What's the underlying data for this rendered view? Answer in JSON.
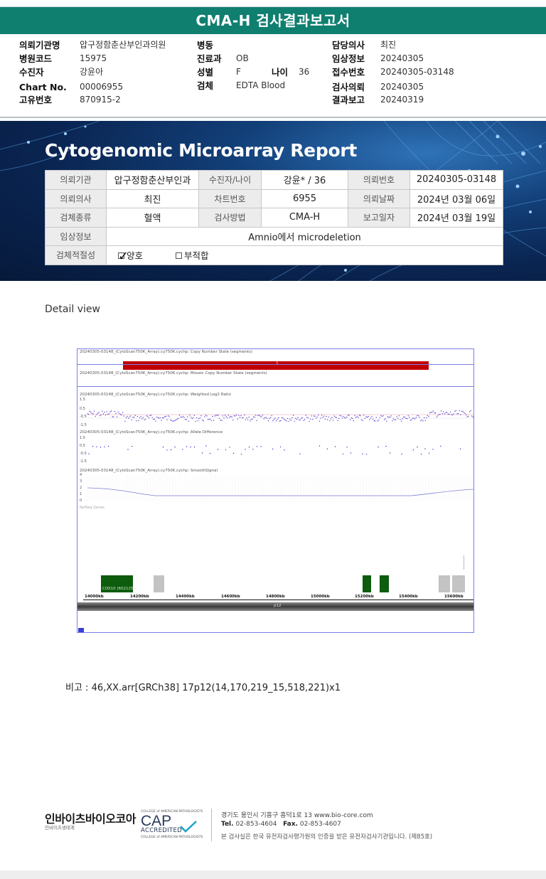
{
  "document_title": "CMA-H 검사결과보고서",
  "header": {
    "col1": [
      {
        "label": "의뢰기관명",
        "value": "압구정함춘산부인과의원"
      },
      {
        "label": "병원코드",
        "value": "15975"
      },
      {
        "label": "수진자",
        "value": "강윤아"
      },
      {
        "label": "Chart No.",
        "value": "00006955"
      },
      {
        "label": "고유번호",
        "value": "870915-2"
      }
    ],
    "col2": [
      {
        "label": "병동",
        "value": ""
      },
      {
        "label": "진료과",
        "value": "OB"
      },
      {
        "label": "성별",
        "value": "F"
      },
      {
        "label": "검체",
        "value": "EDTA Blood"
      }
    ],
    "age": {
      "label": "나이",
      "value": "36"
    },
    "col3": [
      {
        "label": "담당의사",
        "value": "최진"
      },
      {
        "label": "임상정보",
        "value": "20240305"
      },
      {
        "label": "접수번호",
        "value": "20240305-03148"
      },
      {
        "label": "검사의뢰",
        "value": "20240305"
      },
      {
        "label": "결과보고",
        "value": "20240319"
      }
    ]
  },
  "report": {
    "title": "Cytogenomic Microarray Report",
    "table": {
      "r1": {
        "h1": "의뢰기관",
        "v1": "압구정함춘산부인과",
        "h2": "수진자/나이",
        "v2": "강윤* / 36",
        "h3": "의뢰번호",
        "v3": "20240305-03148"
      },
      "r2": {
        "h1": "의뢰의사",
        "v1": "최진",
        "h2": "차트번호",
        "v2": "6955",
        "h3": "의뢰날짜",
        "v3": "2024년 03월 06일"
      },
      "r3": {
        "h1": "검체종류",
        "v1": "혈액",
        "h2": "검사방법",
        "v2": "CMA-H",
        "h3": "보고일자",
        "v3": "2024년 03월 19일"
      },
      "r4": {
        "h1": "임상정보",
        "v1": "Amnio에서 microdeletion"
      },
      "r5": {
        "h1": "검체적절성",
        "opt1": "양호",
        "opt2": "부적합",
        "selected": "양호"
      }
    }
  },
  "detail": {
    "label": "Detail view",
    "tracks": {
      "t1": "20240305-03148_(CytoScan750K_Array).cy750K.cychp: Copy Number State (segments)",
      "t2": "20240305-03148_(CytoScan750K_Array).cy750K.cychp: Mosaic Copy Number State (segments)",
      "t3": "20240305-03148_(CytoScan750K_Array).cy750K.cychp: Weighted Log2 Ratio",
      "t4": "20240305-03148_(CytoScan750K_Array).cy750K.cychp: Allele Difference",
      "t5": "20240305-03148_(CytoScan750K_Array).cy750K.cychp: SmoothSignal"
    },
    "cnv_marker": "1",
    "log2_ticks": [
      "1.5",
      "0.5",
      "-0.5",
      "-1.5"
    ],
    "allele_ticks": [
      "1.5",
      "0.5",
      "-0.5",
      "-1.5"
    ],
    "smooth_ticks": [
      "4",
      "3",
      "2",
      "1",
      "0"
    ],
    "refseq_label": "RefSeq Genes",
    "gene_label": "COX10 (602125)",
    "x_ticks": [
      "14000kb",
      "14200kb",
      "14400kb",
      "14600kb",
      "14800kb",
      "15000kb",
      "15200kb",
      "15400kb",
      "15600kb"
    ],
    "band": "p12"
  },
  "remark": "비고 : 46,XX.arr[GRCh38] 17p12(14,170,219_15,518,221)x1",
  "footer": {
    "logo": "인바이츠바이오코아",
    "logo_sub": "인바이츠생태계",
    "cap_top": "COLLEGE of AMERICAN PATHOLOGISTS",
    "cap_big": "CAP",
    "cap_accredited": "ACCREDITED",
    "cap_bottom": "COLLEGE of AMERICAN PATHOLOGISTS",
    "address": "경기도 용인시 기흥구 흥덕1로 13   www.bio-core.com",
    "tel_label": "Tel.",
    "tel": "02-853-4604",
    "fax_label": "Fax.",
    "fax": "02-853-4607",
    "cert": "본 검사실은 한국 유전자검사평가원의 인증을 받은 유전자검사기관입니다. (제85호)"
  }
}
